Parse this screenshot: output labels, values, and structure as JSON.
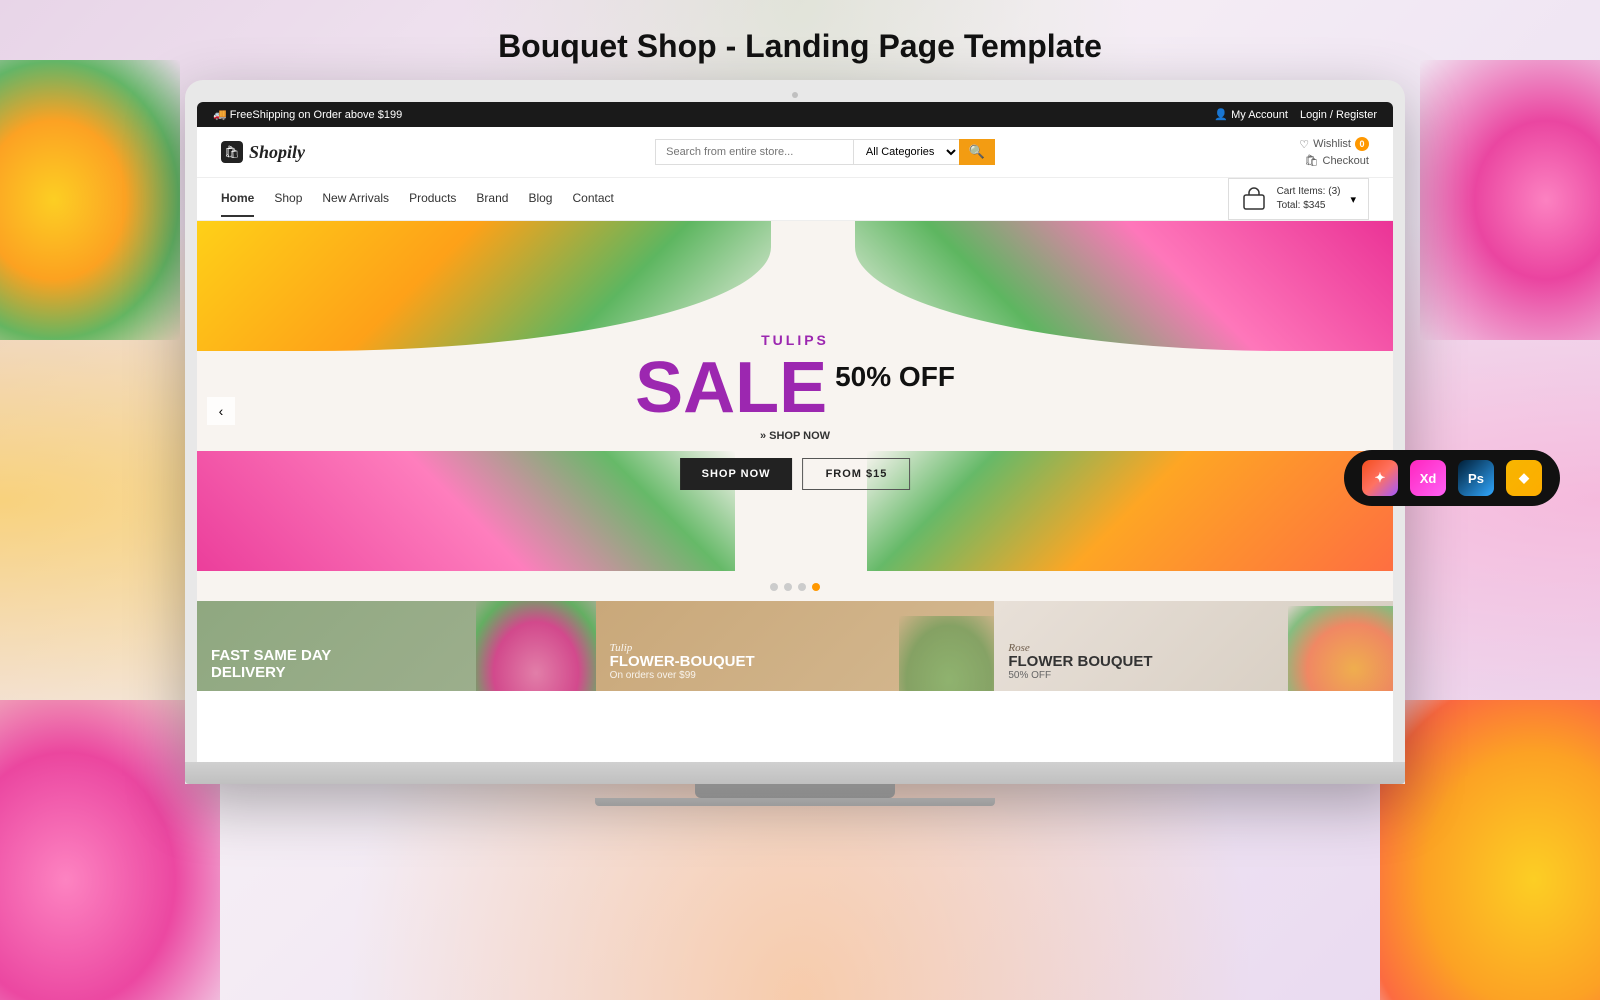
{
  "page": {
    "title": "Bouquet Shop - Landing Page Template"
  },
  "announcement_bar": {
    "shipping_text": "🚚 FreeShipping on Order above $199",
    "account_text": "👤 My Account",
    "auth_text": "Login / Register"
  },
  "header": {
    "logo_text": "Shopily",
    "search_placeholder": "Search from entire store...",
    "search_category": "All Categories",
    "wishlist_label": "Wishlist",
    "wishlist_count": "0",
    "checkout_label": "Checkout"
  },
  "nav": {
    "links": [
      "Home",
      "Shop",
      "New Arrivals",
      "Products",
      "Brand",
      "Blog",
      "Contact"
    ],
    "active_index": 0,
    "cart": {
      "label": "Cart Items: (3)",
      "total": "Total: $345"
    }
  },
  "hero": {
    "tag": "TULIPS",
    "sale_text": "SALE",
    "sale_detail": "50% OFF",
    "shop_link": "» SHOP NOW",
    "btn_shop": "SHOP NOW",
    "btn_from": "FROM $15",
    "dots_count": 4,
    "active_dot": 3
  },
  "feature_cards": [
    {
      "subtitle": "",
      "title": "Fast Same day\nDelivery",
      "desc": ""
    },
    {
      "subtitle": "Tulip",
      "title": "FLOWER-BOUQUET",
      "desc": "On orders over $99"
    },
    {
      "subtitle": "Rose",
      "title": "FLOWER BOUQUET",
      "desc": "50% OFF"
    }
  ],
  "tool_badges": [
    {
      "label": "✦",
      "name": "Figma",
      "class": "badge-figma"
    },
    {
      "label": "Xd",
      "name": "Adobe XD",
      "class": "badge-xd"
    },
    {
      "label": "Ps",
      "name": "Photoshop",
      "class": "badge-ps"
    },
    {
      "label": "◆",
      "name": "Sketch",
      "class": "badge-sketch"
    }
  ],
  "colors": {
    "accent_purple": "#9c27b0",
    "accent_orange": "#ff9800",
    "dark": "#1a1a1a",
    "card1_bg": "#a0ac95",
    "card2_bg": "#c9a87a",
    "card3_bg": "#d8cfc5"
  }
}
